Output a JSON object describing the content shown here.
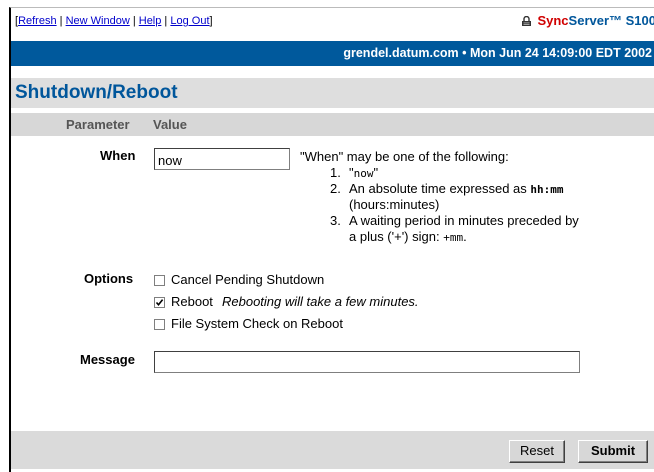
{
  "header": {
    "link_open": "[",
    "links": [
      "Refresh",
      "New Window",
      "Help",
      "Log Out"
    ],
    "link_sep": " | ",
    "link_close": "]",
    "brand_sync": "Sync",
    "brand_rest": "Server™ S100"
  },
  "status_bar": "grendel.datum.com  •  Mon Jun 24 14:09:00 EDT 2002",
  "page_title": "Shutdown/Reboot",
  "columns": {
    "parameter": "Parameter",
    "value": "Value"
  },
  "when": {
    "label": "When",
    "value": "now",
    "help_intro": "\"When\" may be one of the following:",
    "items": [
      {
        "num": "1.",
        "text": "\"",
        "code": "now",
        "after": "\""
      },
      {
        "num": "2.",
        "text": "An absolute time expressed as ",
        "code": "hh:mm",
        "line2": "(hours:minutes)"
      },
      {
        "num": "3.",
        "text": "A waiting period in minutes preceded by",
        "line2": "a plus ('+') sign: ",
        "code2": "+mm",
        "after2": "."
      }
    ]
  },
  "options": {
    "label": "Options",
    "cancel_label": "Cancel Pending Shutdown",
    "cancel_checked": false,
    "reboot_label": "Reboot",
    "reboot_checked": true,
    "reboot_note": "Rebooting will take a few minutes.",
    "fsck_label": "File System Check on Reboot",
    "fsck_checked": false
  },
  "message": {
    "label": "Message",
    "value": ""
  },
  "buttons": {
    "reset": "Reset",
    "submit": "Submit"
  },
  "colors": {
    "brand_red": "#d00000",
    "brand_blue": "#00569b",
    "status_bar": "#00599c"
  }
}
